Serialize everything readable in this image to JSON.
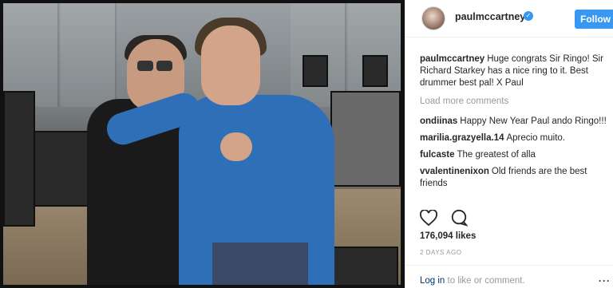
{
  "header": {
    "username": "paulmccartney",
    "follow_label": "Follow"
  },
  "caption": {
    "author": "paulmccartney",
    "text": "Huge congrats Sir Ringo! Sir Richard Starkey has a nice ring to it. Best drummer best pal! X Paul"
  },
  "load_more_label": "Load more comments",
  "comments": [
    {
      "author": "ondiinas",
      "text": "Happy New Year Paul ando Ringo!!!"
    },
    {
      "author": "marilia.grazyella.14",
      "text": "Aprecio muito."
    },
    {
      "author": "fulcaste",
      "text": "The greatest of alla"
    },
    {
      "author": "vvalentinenixon",
      "text": "Old friends are the best friends"
    }
  ],
  "actions": {
    "like_icon": "heart-icon",
    "comment_icon": "comment-icon"
  },
  "likes": "176,094 likes",
  "posted": "2 DAYS AGO",
  "login": {
    "link": "Log in",
    "suffix": " to like or comment.",
    "more": "···"
  }
}
